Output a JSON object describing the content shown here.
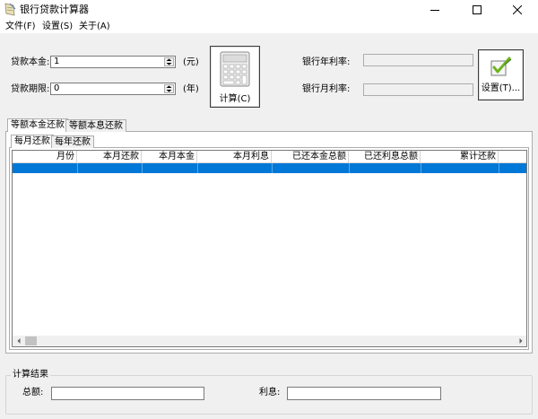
{
  "window": {
    "title": "银行贷款计算器",
    "minimize_icon": "minimize-icon",
    "maximize_icon": "maximize-icon",
    "close_icon": "close-icon"
  },
  "menu": [
    "文件(F)",
    "设置(S)",
    "关于(A)"
  ],
  "inputs": {
    "principal_label": "贷款本金:",
    "principal_value": "1",
    "principal_unit": "(元)",
    "term_label": "贷款期限:",
    "term_value": "0",
    "term_unit": "(年)",
    "calc_label": "计算(C)",
    "annual_rate_label": "银行年利率:",
    "annual_rate_value": "",
    "monthly_rate_label": "银行月利率:",
    "monthly_rate_value": "",
    "settings_label": "设置(T)..."
  },
  "tabs": {
    "outer": [
      "等额本金还款",
      "等额本息还款"
    ],
    "outer_active": 0,
    "inner": [
      "每月还款",
      "每年还款"
    ],
    "inner_active": 0
  },
  "grid": {
    "columns": [
      "月份",
      "本月还款",
      "本月本金",
      "本月利息",
      "已还本金总额",
      "已还利息总额",
      "累计还款"
    ],
    "rows": []
  },
  "results": {
    "group_title": "计算结果",
    "total_label": "总额:",
    "total_value": "",
    "interest_label": "利息:",
    "interest_value": ""
  },
  "colors": {
    "selection": "#0078d7",
    "window_bg": "#f0f0f0"
  }
}
